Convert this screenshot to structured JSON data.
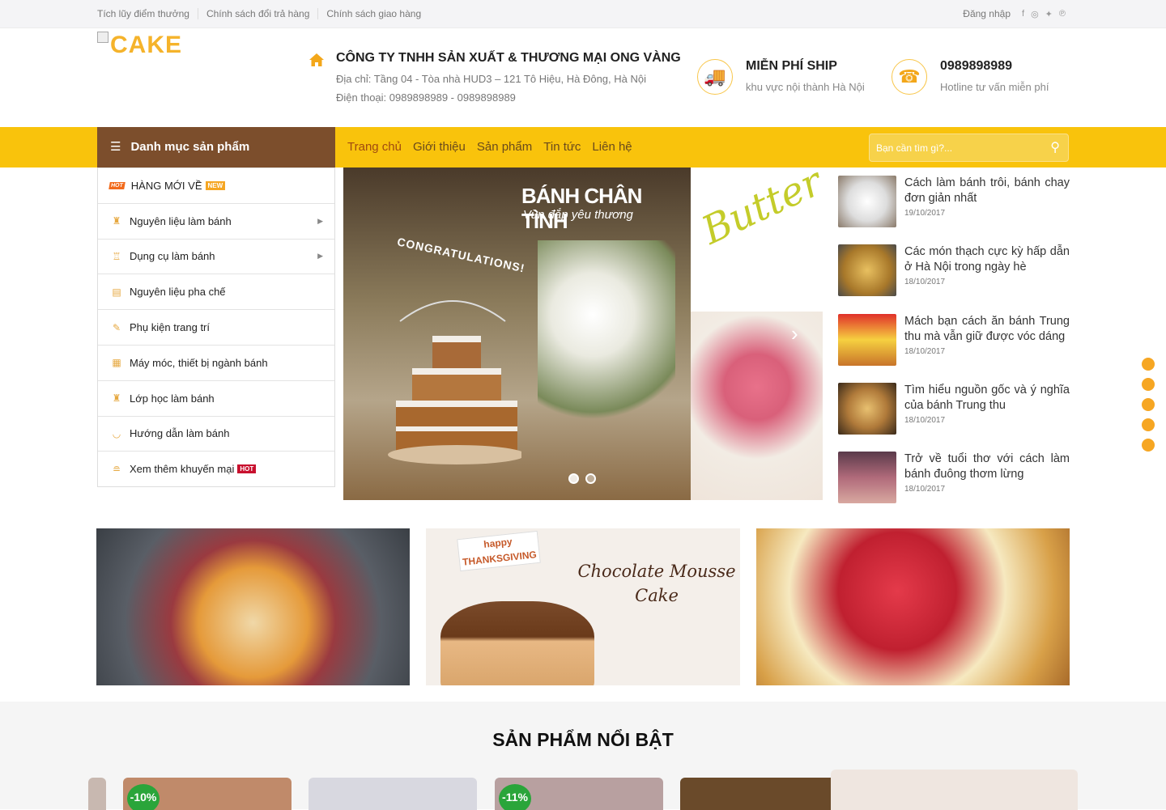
{
  "topbar": {
    "links": [
      "Tích lũy điểm thưởng",
      "Chính sách đổi trả hàng",
      "Chính sách giao hàng"
    ],
    "login": "Đăng nhập",
    "social_icons": [
      "facebook-icon",
      "instagram-icon",
      "twitter-icon",
      "pinterest-icon"
    ]
  },
  "logo": {
    "text": "CAKE"
  },
  "company": {
    "name": "CÔNG TY TNHH SẢN XUẤT & THƯƠNG MẠI ONG VÀNG",
    "address": "Địa chỉ: Tầng 04 - Tòa nhà HUD3 – 121 Tô Hiệu, Hà Đông, Hà Nội",
    "phone": "Điện thoại: 0989898989 - 0989898989"
  },
  "features": [
    {
      "icon": "truck-icon",
      "title": "MIỄN PHÍ SHIP",
      "desc": "khu vực nội thành Hà Nội"
    },
    {
      "icon": "phone-icon",
      "title": "0989898989",
      "desc": "Hotline tư vấn miễn phí"
    }
  ],
  "nav": {
    "category_label": "Danh mục sản phẩm",
    "menu": [
      "Trang chủ",
      "Giới thiệu",
      "Sản phẩm",
      "Tin tức",
      "Liên hệ"
    ],
    "search_placeholder": "Bạn cần tìm gì?..."
  },
  "categories": [
    {
      "label": "HÀNG MỚI VỀ",
      "badge": "NEW",
      "tag": "HOT",
      "arrow": false
    },
    {
      "label": "Nguyên liệu làm bánh",
      "arrow": true
    },
    {
      "label": "Dụng cụ làm bánh",
      "arrow": true
    },
    {
      "label": "Nguyên liệu pha chế",
      "arrow": false
    },
    {
      "label": "Phụ kiện trang trí",
      "arrow": false
    },
    {
      "label": "Máy móc, thiết bị ngành bánh",
      "arrow": false
    },
    {
      "label": "Lớp học làm bánh",
      "arrow": false
    },
    {
      "label": "Hướng dẫn làm bánh",
      "arrow": false
    },
    {
      "label": "Xem thêm khuyến mại",
      "badge": "HOT",
      "arrow": false
    }
  ],
  "slider": {
    "title": "BÁNH CHÂN TÌNH",
    "subtitle": "Vun đắp yêu thương",
    "cake_topper": "CONGRATULATIONS!",
    "side_text": "Butter",
    "slide_count": 2,
    "active_slide": 1
  },
  "news": [
    {
      "title": "Cách làm bánh trôi, bánh chay đơn giản nhất",
      "date": "19/10/2017",
      "thumb_color": "#e8e2d8"
    },
    {
      "title": "Các món thạch cực kỳ hấp dẫn ở Hà Nội trong ngày hè",
      "date": "18/10/2017",
      "thumb_color": "#c8a048"
    },
    {
      "title": "Mách bạn cách ăn bánh Trung thu mà vẫn giữ được vóc dáng",
      "date": "18/10/2017",
      "thumb_color": "#e03a2a"
    },
    {
      "title": "Tìm hiểu nguồn gốc và ý nghĩa của bánh Trung thu",
      "date": "18/10/2017",
      "thumb_color": "#b07a3a"
    },
    {
      "title": "Trở về tuổi thơ với cách làm bánh đuông thơm lừng",
      "date": "18/10/2017",
      "thumb_color": "#6a3a4a"
    }
  ],
  "banners": {
    "banner2_title": "Chocolate Mousse Cake",
    "banner2_tag": "happy THANKSGIVING"
  },
  "featured": {
    "title": "SẢN PHẨM NỔI BẬT",
    "products": [
      {
        "sale": "-10%"
      },
      {
        "sale": ""
      },
      {
        "sale": "-11%"
      },
      {
        "sale": ""
      }
    ]
  }
}
